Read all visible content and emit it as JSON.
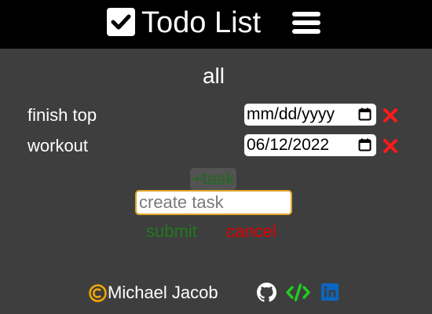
{
  "header": {
    "title": "Todo List",
    "logo_icon": "checkbox-icon",
    "menu_icon": "hamburger-menu-icon"
  },
  "filter": {
    "label": "all"
  },
  "tasks": [
    {
      "name": "finish top",
      "date": "mm/dd/yyyy",
      "delete_icon": "close-icon"
    },
    {
      "name": "workout",
      "date": "06/12/2022",
      "delete_icon": "close-icon"
    }
  ],
  "new_task": {
    "add_label": "+task",
    "placeholder": "create task",
    "value": "",
    "submit_label": "submit",
    "cancel_label": "cancel"
  },
  "footer": {
    "author": "Michael Jacob",
    "icons": [
      "copyright-icon",
      "github-icon",
      "code-icon",
      "linkedin-icon"
    ]
  },
  "colors": {
    "background": "#3e3e3e",
    "header": "#000000",
    "submit": "#1f7a1f",
    "cancel": "#e00000",
    "delete": "#ff1a1a",
    "copyright": "#f2a900",
    "code": "#22cc22",
    "linkedin": "#0a66c2",
    "input_focus": "#e0a52a"
  }
}
